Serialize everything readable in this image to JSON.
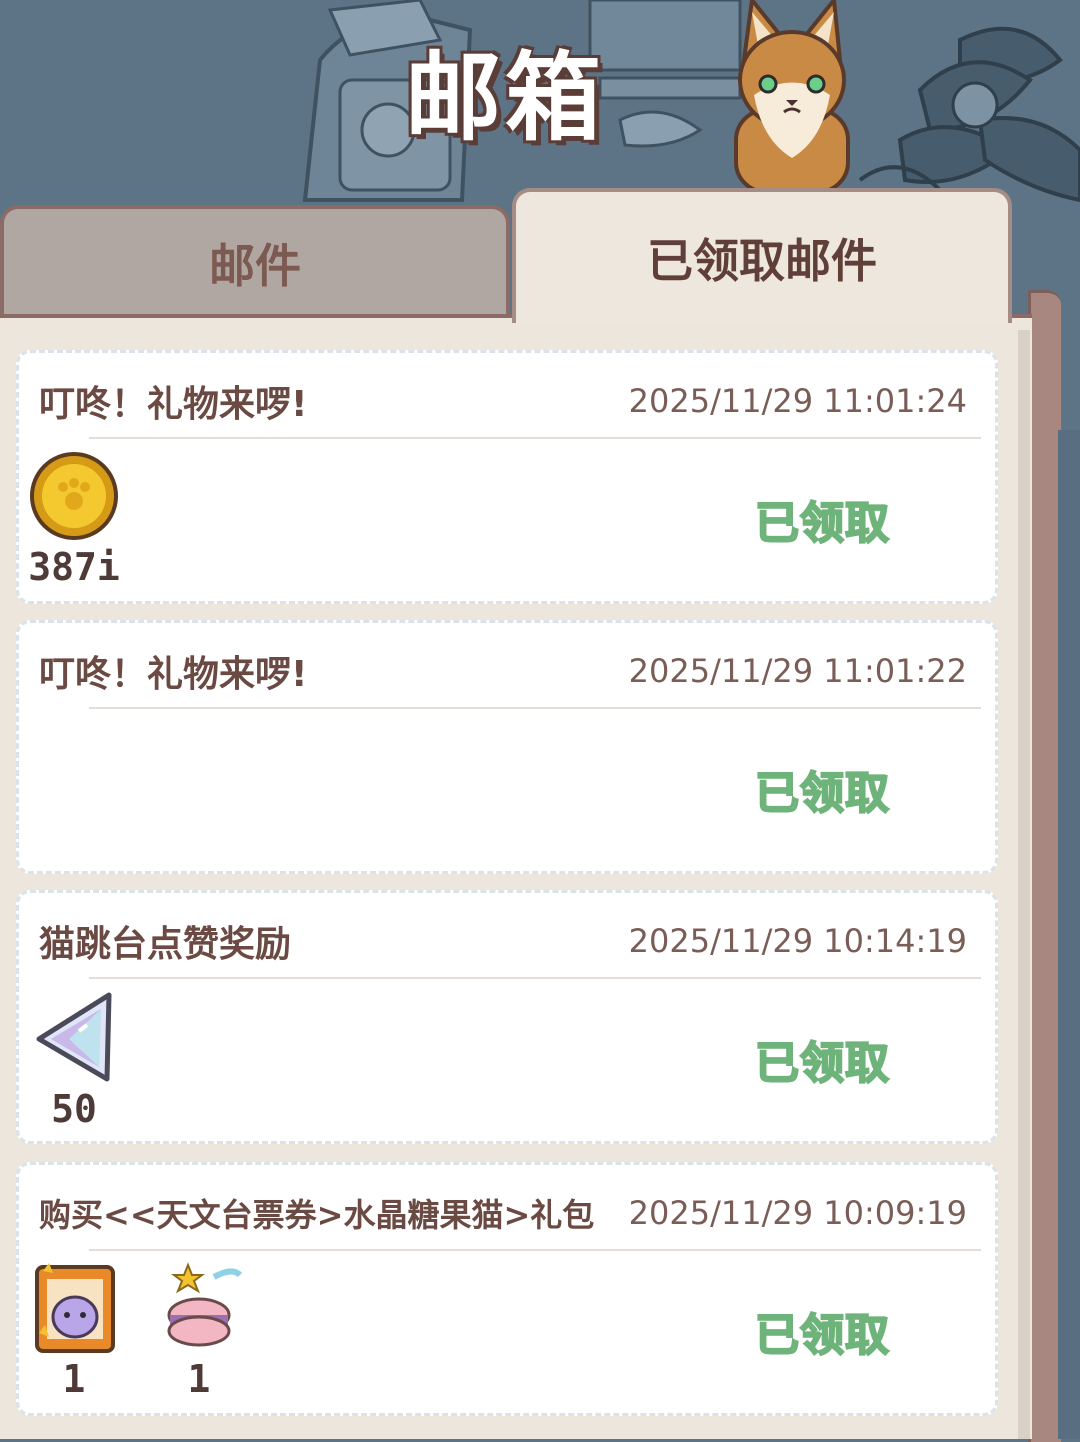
{
  "header": {
    "title": "邮箱"
  },
  "tabs": [
    {
      "label": "邮件",
      "active": false
    },
    {
      "label": "已领取邮件",
      "active": true
    }
  ],
  "mails": [
    {
      "title": "叮咚！礼物来啰!",
      "time": "2025/11/29 11:01:24",
      "status": "已领取",
      "items": [
        {
          "icon": "gold-coin-icon",
          "qty": "387i"
        }
      ]
    },
    {
      "title": "叮咚！礼物来啰!",
      "time": "2025/11/29 11:01:22",
      "status": "已领取",
      "items": []
    },
    {
      "title": "猫跳台点赞奖励",
      "time": "2025/11/29 10:14:19",
      "status": "已领取",
      "items": [
        {
          "icon": "crystal-gem-icon",
          "qty": "50"
        }
      ]
    },
    {
      "title": "购买<<天文台票券>水晶糖果猫>礼包",
      "time": "2025/11/29 10:09:19",
      "status": "已领取",
      "items": [
        {
          "icon": "observatory-ticket-icon",
          "qty": "1"
        },
        {
          "icon": "crystal-candy-cat-icon",
          "qty": "1"
        }
      ]
    }
  ],
  "colors": {
    "background": "#5d7386",
    "panel": "#ece6dd",
    "claimed_text": "#6db37a",
    "title_brown": "#6a4a43"
  }
}
